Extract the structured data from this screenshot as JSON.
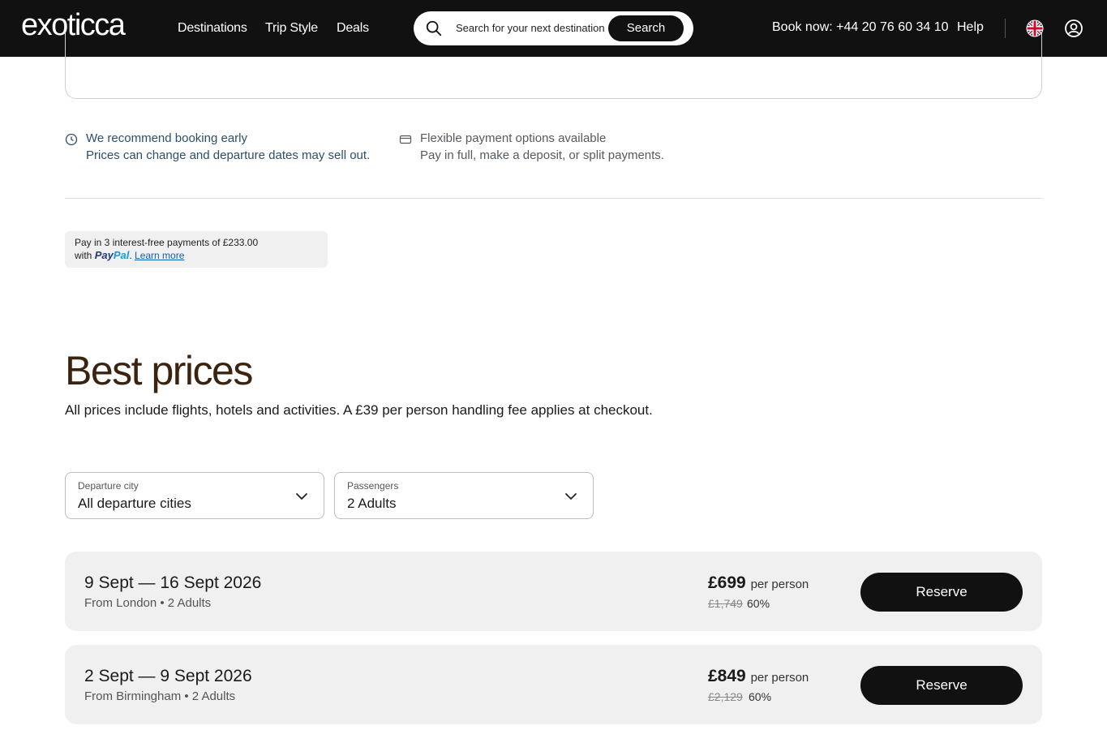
{
  "header": {
    "logo": "exoticca",
    "nav": [
      "Destinations",
      "Trip Style",
      "Deals"
    ],
    "search": {
      "placeholder": "Search for your next destination",
      "button_label": "Search"
    },
    "book_now": "Book now: +44 20 76 60 34 10",
    "help": "Help",
    "icons": {
      "search": "search-icon",
      "flag": "uk-flag-icon",
      "account": "user-account-icon"
    }
  },
  "info": [
    {
      "icon": "clock-icon",
      "title": "We recommend booking early",
      "subtitle": "Prices can change and departure dates may sell out."
    },
    {
      "icon": "credit-card-icon",
      "title": "Flexible payment options available",
      "subtitle": "Pay in full, make a deposit, or split payments."
    }
  ],
  "paypal": {
    "line1": "Pay in 3 interest-free payments of £233.00",
    "with": "with",
    "brand_pay": "Pay",
    "brand_pal": "Pal",
    "learn_more": "Learn more"
  },
  "best_prices": {
    "title": "Best prices",
    "subtitle": "All prices include flights, hotels and activities. A £39 per person handling fee applies at checkout.",
    "filters": [
      {
        "label": "Departure city",
        "value": "All departure cities"
      },
      {
        "label": "Passengers",
        "value": "2 Adults"
      }
    ],
    "departures": [
      {
        "dates": "9 Sept — 16 Sept 2026",
        "meta": "From London • 2 Adults",
        "price": "£699",
        "per_person": "per person",
        "old_price": "£1,749",
        "discount": "60%",
        "button": "Reserve"
      },
      {
        "dates": "2 Sept — 9 Sept 2026",
        "meta": "From Birmingham • 2 Adults",
        "price": "£849",
        "per_person": "per person",
        "old_price": "£2,129",
        "discount": "60%",
        "button": "Reserve"
      }
    ]
  },
  "colors": {
    "header_bg": "#111111",
    "title_brown": "#3a2410",
    "row_bg": "#f0f0f0",
    "info_blue": "#2d4f6b"
  }
}
